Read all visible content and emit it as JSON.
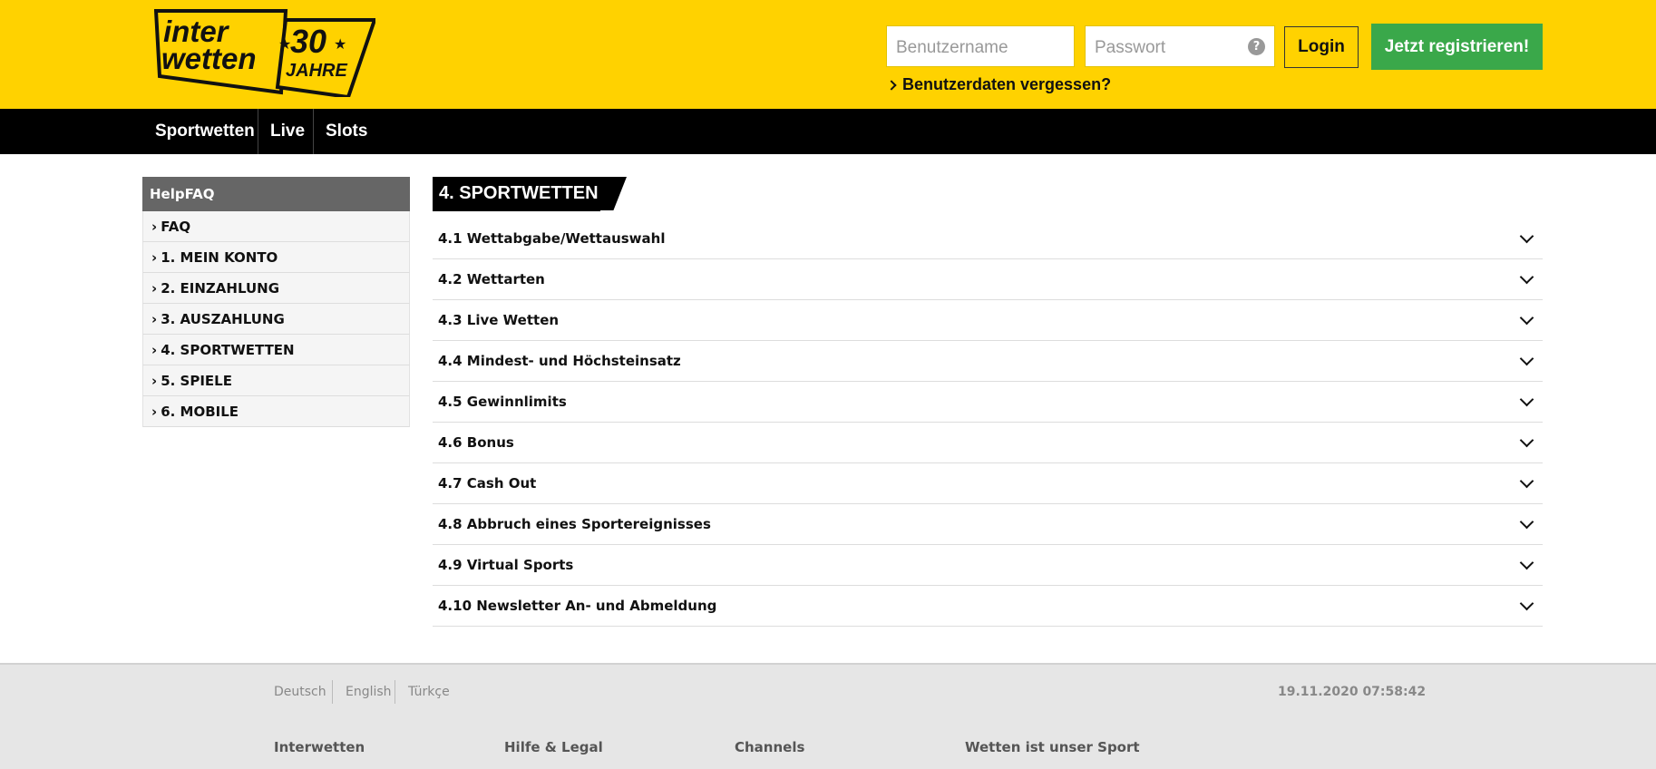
{
  "header": {
    "logo": {
      "line1": "inter",
      "line2": "wetten",
      "anniversary": "30",
      "anniversary_label": "JAHRE"
    },
    "username_placeholder": "Benutzername",
    "password_placeholder": "Passwort",
    "login_label": "Login",
    "register_label": "Jetzt registrieren!",
    "forgot_label": "Benutzerdaten vergessen?",
    "help_icon": "question-circle-icon",
    "background_color": "#ffd200",
    "register_color": "#3aa84a"
  },
  "nav": {
    "items": [
      {
        "label": "Sportwetten"
      },
      {
        "label": "Live"
      },
      {
        "label": "Slots"
      }
    ]
  },
  "sidebar": {
    "title": "HelpFAQ",
    "items": [
      {
        "label": "FAQ"
      },
      {
        "label": "1. MEIN KONTO"
      },
      {
        "label": "2. EINZAHLUNG"
      },
      {
        "label": "3. AUSZAHLUNG"
      },
      {
        "label": "4. SPORTWETTEN"
      },
      {
        "label": "5. SPIELE"
      },
      {
        "label": "6. MOBILE"
      }
    ]
  },
  "main": {
    "section_title": "4. SPORTWETTEN",
    "faq_items": [
      {
        "label": "4.1 Wettabgabe/Wettauswahl"
      },
      {
        "label": "4.2 Wettarten"
      },
      {
        "label": "4.3 Live Wetten"
      },
      {
        "label": "4.4 Mindest- und Höchsteinsatz"
      },
      {
        "label": "4.5 Gewinnlimits"
      },
      {
        "label": "4.6 Bonus"
      },
      {
        "label": "4.7 Cash Out"
      },
      {
        "label": "4.8 Abbruch eines Sportereignisses"
      },
      {
        "label": "4.9 Virtual Sports"
      },
      {
        "label": "4.10 Newsletter An- und Abmeldung"
      }
    ]
  },
  "footer": {
    "languages": [
      {
        "label": "Deutsch"
      },
      {
        "label": "English"
      },
      {
        "label": "Türkçe"
      }
    ],
    "timestamp": "19.11.2020 07:58:42",
    "columns": [
      {
        "heading": "Interwetten"
      },
      {
        "heading": "Hilfe & Legal"
      },
      {
        "heading": "Channels"
      },
      {
        "heading": "Wetten ist unser Sport"
      }
    ]
  }
}
